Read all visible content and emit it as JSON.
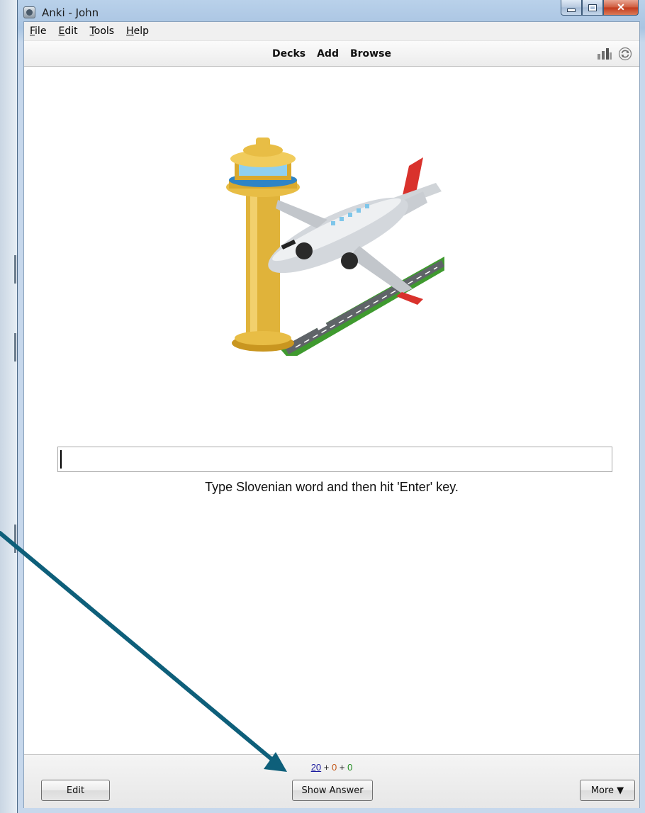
{
  "window": {
    "title": "Anki - John"
  },
  "menubar": {
    "items": [
      {
        "mnemonic": "F",
        "rest": "ile"
      },
      {
        "mnemonic": "E",
        "rest": "dit"
      },
      {
        "mnemonic": "T",
        "rest": "ools"
      },
      {
        "mnemonic": "H",
        "rest": "elp"
      }
    ]
  },
  "toolbar": {
    "links": [
      "Decks",
      "Add",
      "Browse"
    ],
    "icons": [
      "stats-icon",
      "sync-icon"
    ]
  },
  "card": {
    "image": "airplane-control-tower-runway",
    "input_value": "",
    "hint": "Type Slovenian word and then hit 'Enter' key."
  },
  "bottombar": {
    "counts": {
      "new": "20",
      "learn": "0",
      "review": "0",
      "plus": "+"
    },
    "edit_label": "Edit",
    "show_answer_label": "Show Answer",
    "more_label": "More ▼"
  },
  "colors": {
    "new_count": "#1a1a9e",
    "learn_count": "#c35617",
    "review_count": "#1e8c1e",
    "annotation_arrow": "#0e5f7a"
  }
}
